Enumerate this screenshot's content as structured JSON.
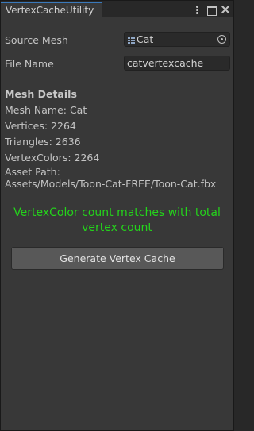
{
  "window": {
    "tab_title": "VertexCacheUtility",
    "controls": [
      "more-options-icon",
      "maximize-icon",
      "close-icon"
    ]
  },
  "fields": {
    "source_mesh_label": "Source Mesh",
    "source_mesh_value": "Cat",
    "file_name_label": "File Name",
    "file_name_value": "catvertexcache"
  },
  "details": {
    "title": "Mesh Details",
    "mesh_name": "Mesh Name: Cat",
    "vertices": "Vertices: 2264",
    "triangles": "Triangles: 2636",
    "vertex_colors": "VertexColors: 2264",
    "asset_path_label": "Asset Path:",
    "asset_path": "Assets/Models/Toon-Cat-FREE/Toon-Cat.fbx"
  },
  "status": {
    "line1": "VertexColor count matches with total",
    "line2": "vertex count",
    "color": "#24d41b"
  },
  "actions": {
    "generate_label": "Generate Vertex Cache"
  },
  "colors": {
    "background": "#383838",
    "tab_accent": "#3a79bb",
    "button": "#585858"
  }
}
